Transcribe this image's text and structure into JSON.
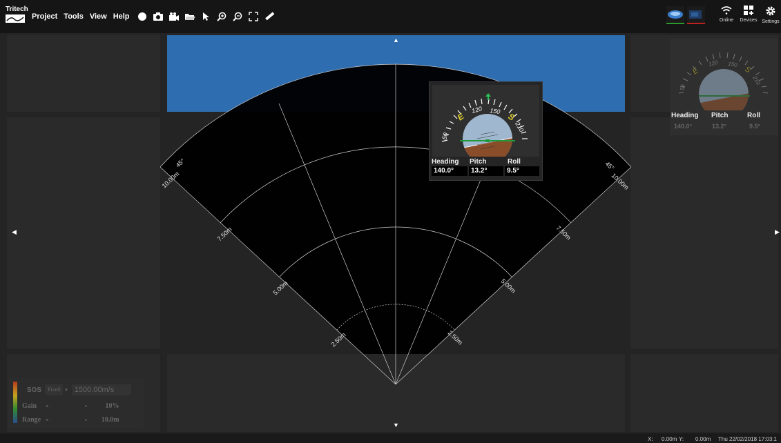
{
  "app": {
    "logo_text": "Tritech"
  },
  "menu": {
    "items": [
      {
        "label": "Project"
      },
      {
        "label": "Tools"
      },
      {
        "label": "View"
      },
      {
        "label": "Help"
      }
    ]
  },
  "toolbar": {
    "icons": [
      "record-icon",
      "camera-icon",
      "video-camera-icon",
      "folder-open-icon",
      "pointer-icon",
      "zoom-in-icon",
      "zoom-out-icon",
      "fullscreen-icon",
      "measure-icon"
    ]
  },
  "top_right": {
    "online_label": "Online",
    "devices_label": "Devices",
    "settings_label": "Settings",
    "device_status_colors": [
      "#2a9a2a",
      "#c02020"
    ]
  },
  "sonar": {
    "ranges": [
      "2.50m",
      "5.00m",
      "7.50m",
      "10.00m"
    ],
    "range_right": [
      "2.50m",
      "5.00m",
      "7.50m",
      "10.00m"
    ],
    "angle_left": "45°",
    "angle_right": "45°"
  },
  "attitude": {
    "heading_label": "Heading",
    "pitch_label": "Pitch",
    "roll_label": "Roll",
    "heading_value": "140.0°",
    "pitch_value": "13.2°",
    "roll_value": "9.5°",
    "compass_labels": [
      "50",
      "E",
      "120",
      "150",
      "S",
      "210"
    ]
  },
  "attitude_mini": {
    "heading_label": "Heading",
    "pitch_label": "Pitch",
    "roll_label": "Roll",
    "heading_value": "140.0°",
    "pitch_value": "13.2°",
    "roll_value": "9.5°",
    "compass_labels": [
      "50",
      "E",
      "120",
      "150",
      "S",
      "210"
    ]
  },
  "controls": {
    "sos_label": "SOS",
    "sos_mode": "Fixed",
    "sos_value": "1500.00m/s",
    "gain_label": "Gain",
    "gain_value": "10%",
    "range_label": "Range",
    "range_value": "10.0m"
  },
  "status": {
    "x_label": "X:",
    "x_value": "0.00m",
    "y_label": "Y:",
    "y_value": "0.00m",
    "datetime": "Thu 22/02/2018 17:03:1"
  }
}
